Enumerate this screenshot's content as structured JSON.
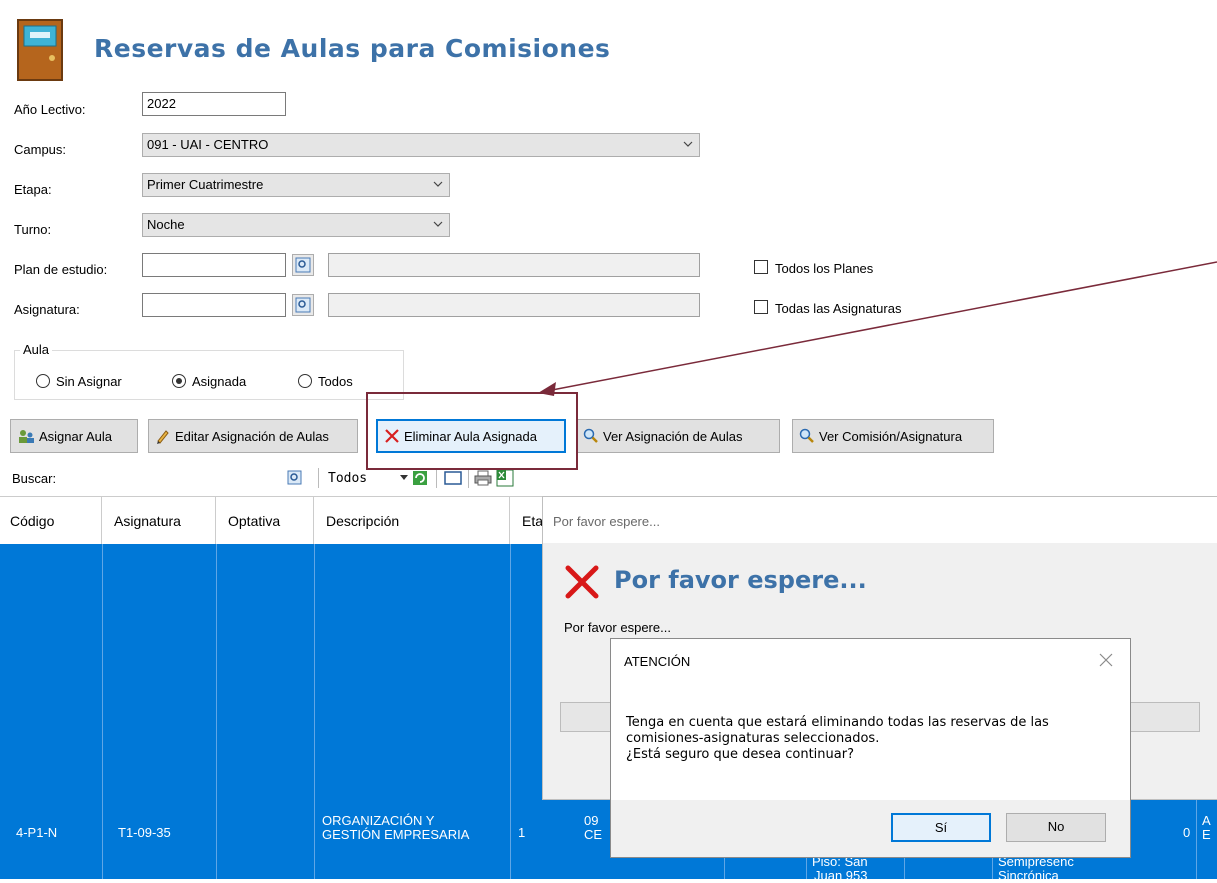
{
  "window": {
    "title": "Reservas de Aulas para Comisiones"
  },
  "form": {
    "anio_label": "Año Lectivo:",
    "anio_value": "2022",
    "campus_label": "Campus:",
    "campus_value": "091 - UAI - CENTRO",
    "etapa_label": "Etapa:",
    "etapa_value": "Primer Cuatrimestre",
    "turno_label": "Turno:",
    "turno_value": "Noche",
    "plan_label": "Plan de estudio:",
    "asignatura_label": "Asignatura:",
    "todos_planes_label": "Todos los Planes",
    "todas_asignaturas_label": "Todas las Asignaturas"
  },
  "aula_group": {
    "legend": "Aula",
    "options": [
      "Sin Asignar",
      "Asignada",
      "Todos"
    ],
    "selected": "Asignada"
  },
  "toolbar": {
    "asignar": "Asignar Aula",
    "editar": "Editar Asignación de Aulas",
    "eliminar": "Eliminar Aula Asignada",
    "ver_asignacion": "Ver Asignación de Aulas",
    "ver_comision": "Ver Comisión/Asignatura"
  },
  "search": {
    "label": "Buscar:",
    "filter": "Todos"
  },
  "grid": {
    "columns": [
      "Código",
      "Asignatura",
      "Optativa",
      "Descripción",
      "Eta"
    ],
    "row": {
      "codigo": "4-P1-N",
      "asignatura": "T1-09-35",
      "descripcion_1": "ORGANIZACIÓN Y",
      "descripcion_2": "GESTIÓN EMPRESARIA",
      "etapa": "1",
      "partial_a": "09",
      "partial_b": "CE",
      "partial_c": "Piso: San",
      "partial_d": "Juan 953",
      "partial_e": "Semipresenc",
      "partial_f": "Sincrónica",
      "count": "0",
      "partial_g": "A",
      "partial_h": "E"
    }
  },
  "wait_window": {
    "titlebar": "Por favor espere...",
    "heading": "Por favor espere...",
    "message": "Por favor espere..."
  },
  "dialog": {
    "title": "ATENCIÓN",
    "message_1": "Tenga en cuenta que estará eliminando todas las reservas de las",
    "message_2": "comisiones-asignaturas seleccionados.",
    "message_3": "¿Está seguro que desea continuar?",
    "yes": "Sí",
    "no": "No"
  },
  "colors": {
    "title": "#3d72a8",
    "selection": "#0078d7",
    "annotation": "#7a2a3a"
  }
}
